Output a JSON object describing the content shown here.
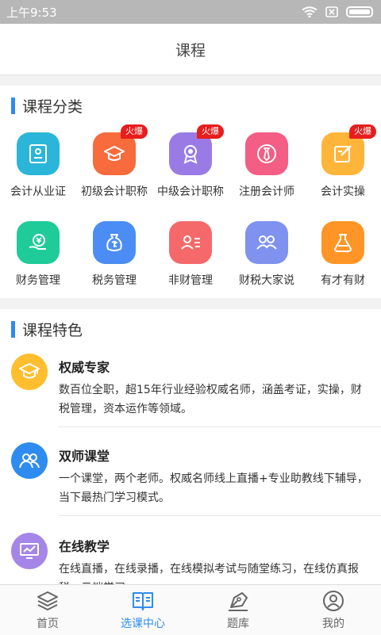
{
  "status_bar": {
    "time": "上午9:53",
    "icons": [
      "wifi-icon",
      "no-sim-icon",
      "battery-icon"
    ]
  },
  "header": {
    "title": "课程"
  },
  "categories": {
    "title": "课程分类",
    "items": [
      {
        "label": "会计从业证",
        "icon": "id-card-icon",
        "color": "#2bb6d9",
        "badge": ""
      },
      {
        "label": "初级会计职称",
        "icon": "graduation-cap-icon",
        "color": "#f76b3c",
        "badge": "火爆"
      },
      {
        "label": "中级会计职称",
        "icon": "medal-icon",
        "color": "#9a7be6",
        "badge": "火爆"
      },
      {
        "label": "注册会计师",
        "icon": "tie-icon",
        "color": "#f45d84",
        "badge": ""
      },
      {
        "label": "会计实操",
        "icon": "edit-icon",
        "color": "#ffb43a",
        "badge": "火爆"
      },
      {
        "label": "财务管理",
        "icon": "money-hand-icon",
        "color": "#1fcb98",
        "badge": ""
      },
      {
        "label": "税务管理",
        "icon": "money-bag-icon",
        "color": "#4b8df4",
        "badge": ""
      },
      {
        "label": "非财管理",
        "icon": "person-list-icon",
        "color": "#f5696a",
        "badge": ""
      },
      {
        "label": "财税大家说",
        "icon": "group-icon",
        "color": "#7f92ef",
        "badge": ""
      },
      {
        "label": "有才有财",
        "icon": "treasure-icon",
        "color": "#ff9526",
        "badge": ""
      }
    ]
  },
  "features": {
    "title": "课程特色",
    "items": [
      {
        "title": "权威专家",
        "desc": "数百位全职，超15年行业经验权威名师，涵盖考证，实操，财税管理，资本运作等领域。",
        "icon": "graduation-cap-icon",
        "color": "#ffbe2e"
      },
      {
        "title": "双师课堂",
        "desc": "一个课堂，两个老师。权威名师线上直播+专业助教线下辅导，当下最热门学习模式。",
        "icon": "two-people-icon",
        "color": "#2e8cf0"
      },
      {
        "title": "在线教学",
        "desc": "在线直播，在线录播，在线模拟考试与随堂练习，在线仿真报税，云端学习",
        "icon": "monitor-chart-icon",
        "color": "#a585e8"
      }
    ]
  },
  "tabbar": {
    "active_color": "#2e8cf0",
    "items": [
      {
        "label": "首页",
        "icon": "layers-icon",
        "active": false
      },
      {
        "label": "选课中心",
        "icon": "open-book-icon",
        "active": true
      },
      {
        "label": "题库",
        "icon": "pen-icon",
        "active": false
      },
      {
        "label": "我的",
        "icon": "user-icon",
        "active": false
      }
    ]
  }
}
